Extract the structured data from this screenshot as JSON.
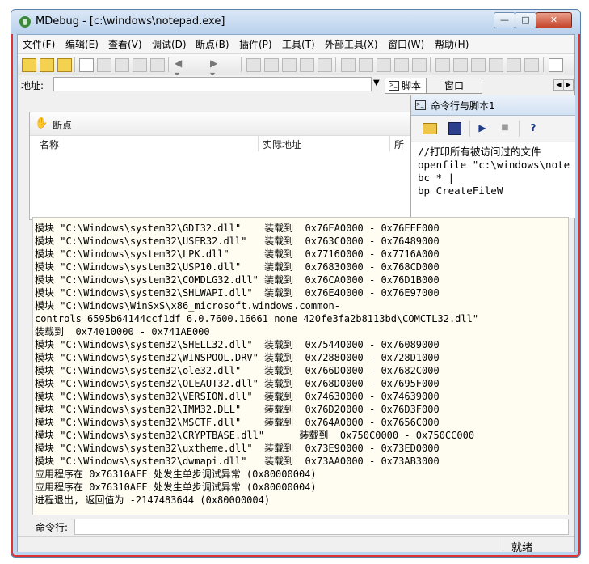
{
  "window": {
    "title": "MDebug - [c:\\windows\\notepad.exe]"
  },
  "controls": {
    "minimize": "—",
    "maximize": "□",
    "close": "✕"
  },
  "menu": [
    "文件(F)",
    "编辑(E)",
    "查看(V)",
    "调试(D)",
    "断点(B)",
    "插件(P)",
    "工具(T)",
    "外部工具(X)",
    "窗口(W)",
    "帮助(H)"
  ],
  "address": {
    "label": "地址:",
    "value": ""
  },
  "tabs": {
    "script": "脚本",
    "window": "窗口"
  },
  "breakpoints": {
    "title": "断点",
    "col_name": "名称",
    "col_addr": "实际地址",
    "col_extra": "所"
  },
  "cmd_panel": {
    "title": "命令行与脚本1",
    "script_lines": [
      "//打印所有被访问过的文件",
      "openfile \"c:\\windows\\note",
      "bc * |",
      "bp CreateFileW"
    ]
  },
  "output_lines": [
    "模块 \"C:\\Windows\\system32\\GDI32.dll\"    装载到  0x76EA0000 - 0x76EEE000",
    "模块 \"C:\\Windows\\system32\\USER32.dll\"   装载到  0x763C0000 - 0x76489000",
    "模块 \"C:\\Windows\\system32\\LPK.dll\"      装载到  0x77160000 - 0x7716A000",
    "模块 \"C:\\Windows\\system32\\USP10.dll\"    装载到  0x76830000 - 0x768CD000",
    "模块 \"C:\\Windows\\system32\\COMDLG32.dll\" 装载到  0x76CA0000 - 0x76D1B000",
    "模块 \"C:\\Windows\\system32\\SHLWAPI.dll\"  装载到  0x76E40000 - 0x76E97000",
    "模块 \"C:\\Windows\\WinSxS\\x86_microsoft.windows.common-",
    "controls_6595b64144ccf1df_6.0.7600.16661_none_420fe3fa2b8113bd\\COMCTL32.dll\"",
    "装载到  0x74010000 - 0x741AE000",
    "模块 \"C:\\Windows\\system32\\SHELL32.dll\"  装载到  0x75440000 - 0x76089000",
    "模块 \"C:\\Windows\\system32\\WINSPOOL.DRV\" 装载到  0x72880000 - 0x728D1000",
    "模块 \"C:\\Windows\\system32\\ole32.dll\"    装载到  0x766D0000 - 0x7682C000",
    "模块 \"C:\\Windows\\system32\\OLEAUT32.dll\" 装载到  0x768D0000 - 0x7695F000",
    "模块 \"C:\\Windows\\system32\\VERSION.dll\"  装载到  0x74630000 - 0x74639000",
    "模块 \"C:\\Windows\\system32\\IMM32.DLL\"    装载到  0x76D20000 - 0x76D3F000",
    "模块 \"C:\\Windows\\system32\\MSCTF.dll\"    装载到  0x764A0000 - 0x7656C000",
    "模块 \"C:\\Windows\\system32\\CRYPTBASE.dll\"      装载到  0x750C0000 - 0x750CC000",
    "模块 \"C:\\Windows\\system32\\uxtheme.dll\"  装载到  0x73E90000 - 0x73ED0000",
    "模块 \"C:\\Windows\\system32\\dwmapi.dll\"   装载到  0x73AA0000 - 0x73AB3000",
    "应用程序在 0x76310AFF 处发生单步调试异常 (0x80000004)",
    "应用程序在 0x76310AFF 处发生单步调试异常 (0x80000004)",
    "进程退出, 返回值为 -2147483644 (0x80000004)"
  ],
  "cmdline": {
    "label": "命令行:",
    "value": ""
  },
  "status": {
    "text": "就绪"
  }
}
